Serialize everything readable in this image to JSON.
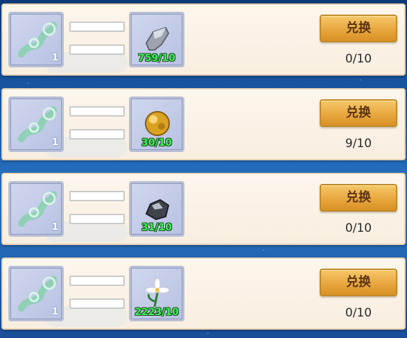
{
  "rows": [
    {
      "source_qty": "1",
      "target_progress": "759/10",
      "button_label": "兑换",
      "count": "0/10",
      "target_item": "silver-ore"
    },
    {
      "source_qty": "1",
      "target_progress": "30/10",
      "button_label": "兑换",
      "count": "9/10",
      "target_item": "gold-ore"
    },
    {
      "source_qty": "1",
      "target_progress": "31/10",
      "button_label": "兑换",
      "count": "0/10",
      "target_item": "iron-ore"
    },
    {
      "source_qty": "1",
      "target_progress": "2223/10",
      "button_label": "兑换",
      "count": "0/10",
      "target_item": "white-lily"
    }
  ],
  "colors": {
    "button": "#e8a73e",
    "progress_text": "#3ff05a",
    "panel": "#fdf6ec"
  }
}
